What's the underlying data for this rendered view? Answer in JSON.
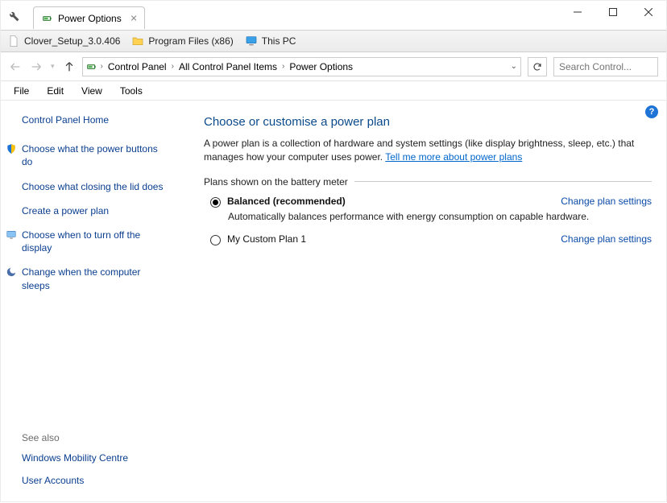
{
  "window": {
    "tab_title": "Power Options"
  },
  "bookmarks": {
    "items": [
      {
        "label": "Clover_Setup_3.0.406",
        "icon": "file"
      },
      {
        "label": "Program Files (x86)",
        "icon": "folder"
      },
      {
        "label": "This PC",
        "icon": "pc"
      }
    ]
  },
  "breadcrumb": {
    "items": [
      "Control Panel",
      "All Control Panel Items",
      "Power Options"
    ]
  },
  "search": {
    "placeholder": "Search Control..."
  },
  "menus": [
    "File",
    "Edit",
    "View",
    "Tools"
  ],
  "sidebar": {
    "home": "Control Panel Home",
    "links": [
      {
        "label": "Choose what the power buttons do",
        "icon": "shield"
      },
      {
        "label": "Choose what closing the lid does"
      },
      {
        "label": "Create a power plan"
      },
      {
        "label": "Choose when to turn off the display",
        "icon": "monitor"
      },
      {
        "label": "Change when the computer sleeps",
        "icon": "moon"
      }
    ],
    "see_also_label": "See also",
    "see_also": [
      "Windows Mobility Centre",
      "User Accounts"
    ]
  },
  "main": {
    "title": "Choose or customise a power plan",
    "desc": "A power plan is a collection of hardware and system settings (like display brightness, sleep, etc.) that manages how your computer uses power. ",
    "learn_more": "Tell me more about power plans",
    "fieldset_label": "Plans shown on the battery meter",
    "plans": [
      {
        "name": "Balanced (recommended)",
        "selected": true,
        "sub": "Automatically balances performance with energy consumption on capable hardware.",
        "change": "Change plan settings"
      },
      {
        "name": "My Custom Plan 1",
        "selected": false,
        "sub": "",
        "change": "Change plan settings"
      }
    ],
    "help_tooltip": "?"
  }
}
